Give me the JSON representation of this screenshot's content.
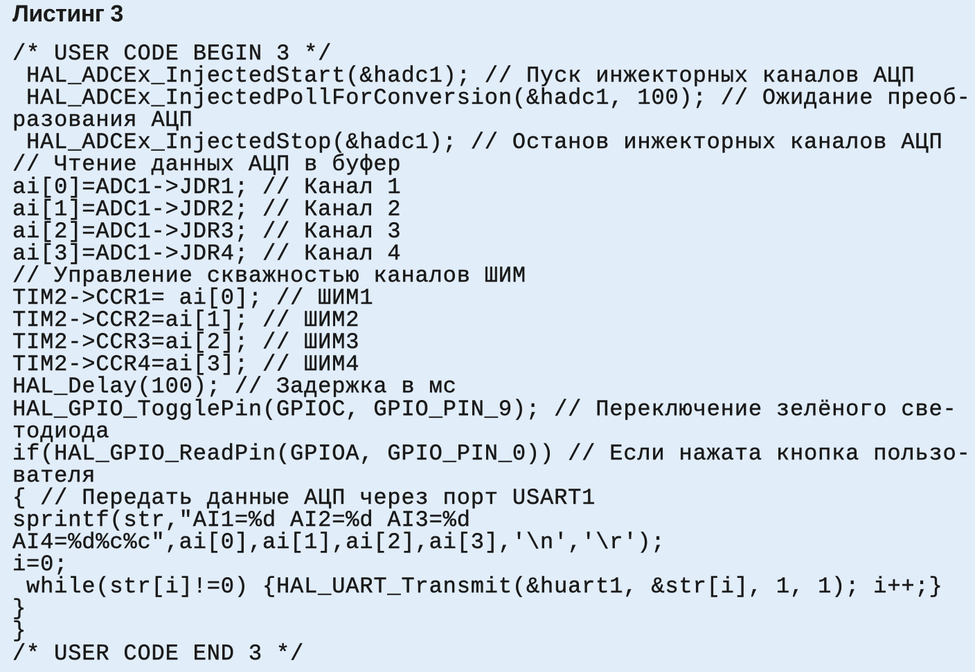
{
  "listing": {
    "title": "Листинг 3",
    "lines": [
      "/* USER CODE BEGIN 3 */",
      " HAL_ADCEx_InjectedStart(&hadc1); // Пуск инжекторных каналов АЦП",
      " HAL_ADCEx_InjectedPollForConversion(&hadc1, 100); // Ожидание преоб-",
      "разования АЦП",
      " HAL_ADCEx_InjectedStop(&hadc1); // Останов инжекторных каналов АЦП",
      "// Чтение данных АЦП в буфер",
      "ai[0]=ADC1->JDR1; // Канал 1",
      "ai[1]=ADC1->JDR2; // Канал 2",
      "ai[2]=ADC1->JDR3; // Канал 3",
      "ai[3]=ADC1->JDR4; // Канал 4",
      "// Управление скважностью каналов ШИМ",
      "TIM2->CCR1= ai[0]; // ШИМ1",
      "TIM2->CCR2=ai[1]; // ШИМ2",
      "TIM2->CCR3=ai[2]; // ШИМ3",
      "TIM2->CCR4=ai[3]; // ШИМ4",
      "HAL_Delay(100); // Задержка в мс",
      "HAL_GPIO_TogglePin(GPIOC, GPIO_PIN_9); // Переключение зелёного све-",
      "тодиода",
      "if(HAL_GPIO_ReadPin(GPIOA, GPIO_PIN_0)) // Если нажата кнопка пользо-",
      "вателя",
      "{ // Передать данные АЦП через порт USART1",
      "sprintf(str,\"AI1=%d AI2=%d AI3=%d",
      "AI4=%d%c%c\",ai[0],ai[1],ai[2],ai[3],'\\n','\\r');",
      "i=0;",
      " while(str[i]!=0) {HAL_UART_Transmit(&huart1, &str[i], 1, 1); i++;}",
      "}",
      "}",
      "/* USER CODE END 3 */"
    ]
  }
}
